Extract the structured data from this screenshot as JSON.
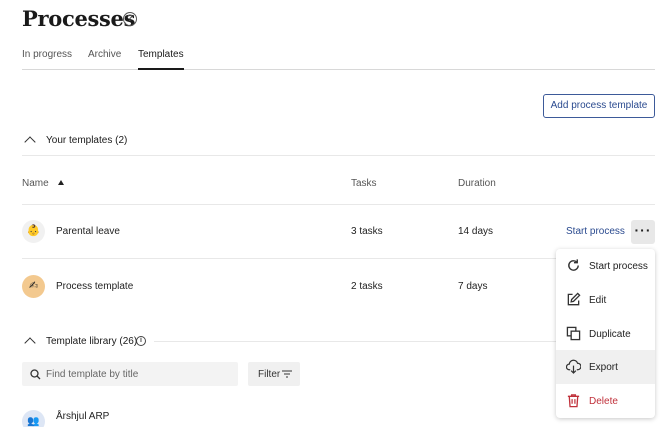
{
  "page": {
    "title": "Processes"
  },
  "tabs": [
    {
      "label": "In progress"
    },
    {
      "label": "Archive"
    },
    {
      "label": "Templates"
    }
  ],
  "toolbar": {
    "add_label": "Add process template"
  },
  "your_templates": {
    "heading": "Your templates (2)",
    "columns": {
      "name": "Name",
      "tasks": "Tasks",
      "duration": "Duration"
    },
    "rows": [
      {
        "name": "Parental leave",
        "tasks": "3 tasks",
        "duration": "14 days",
        "emoji": "👶",
        "avatar_bg": "#f1f1f1",
        "action": "Start process"
      },
      {
        "name": "Process template",
        "tasks": "2 tasks",
        "duration": "7 days",
        "emoji": "✍",
        "avatar_bg": "#f3c98f"
      }
    ]
  },
  "menu": {
    "items": [
      {
        "label": "Start process",
        "icon": "refresh-icon"
      },
      {
        "label": "Edit",
        "icon": "edit-icon"
      },
      {
        "label": "Duplicate",
        "icon": "duplicate-icon"
      },
      {
        "label": "Export",
        "icon": "export-icon"
      },
      {
        "label": "Delete",
        "icon": "trash-icon"
      }
    ],
    "delete_color": "#c0303a"
  },
  "library": {
    "heading": "Template library (26)",
    "search_placeholder": "Find template by title",
    "filter_label": "Filter",
    "rows": [
      {
        "name": "Årshjul ARP",
        "emoji": "👥",
        "avatar_bg": "#dde6f5"
      }
    ]
  },
  "colors": {
    "accent": "#2a4a8f",
    "danger": "#c0303a"
  }
}
